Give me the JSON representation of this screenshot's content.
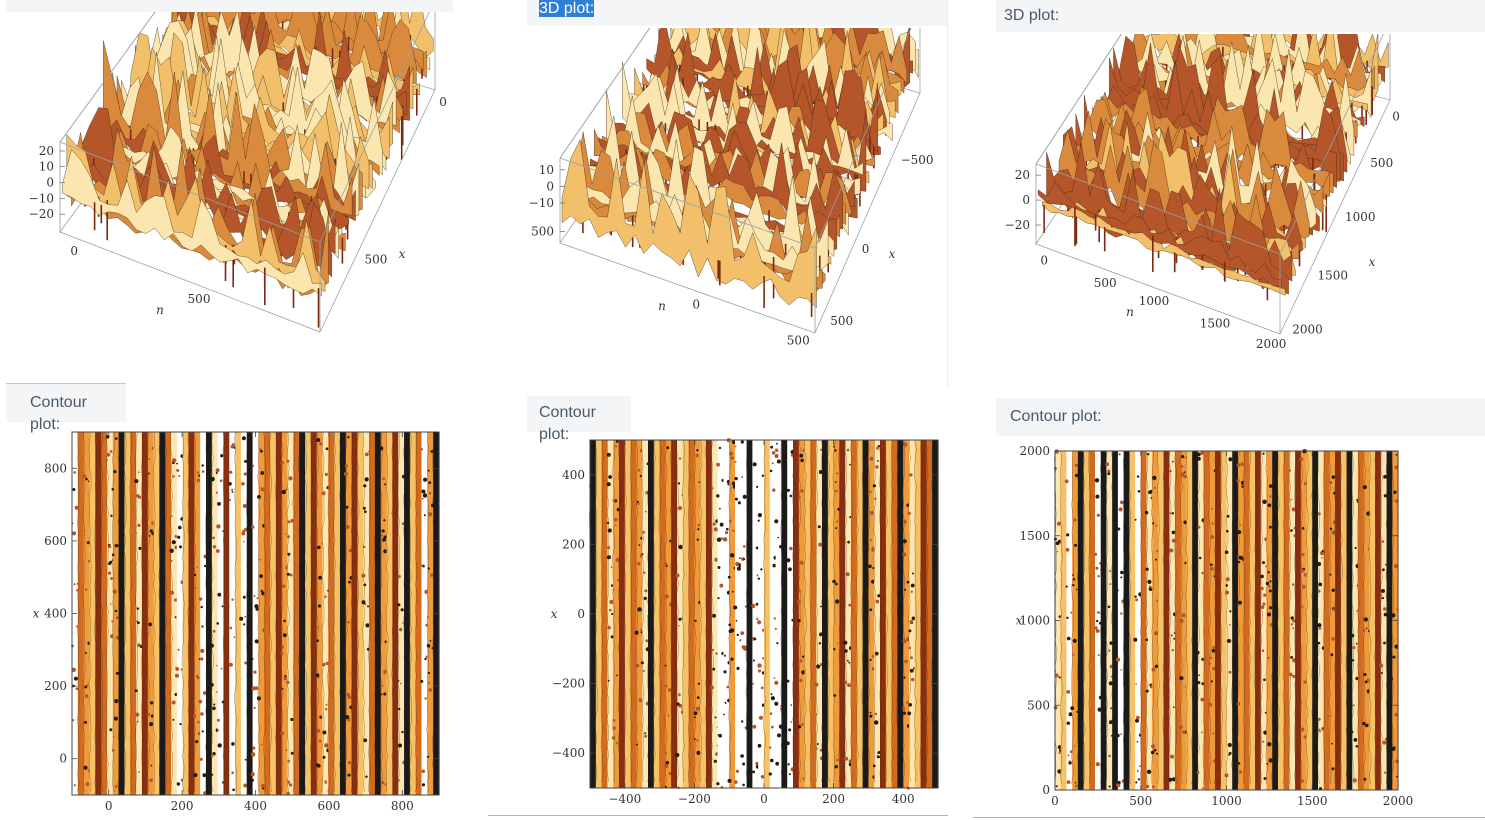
{
  "panels": [
    {
      "label_3d": "",
      "label_contour": "Contour plot:",
      "plot3d": {
        "z_ticks": [
          "20",
          "10",
          "0",
          "−10",
          "−20"
        ],
        "n_ticks": [
          "0",
          "500"
        ],
        "x_ticks": [
          "500",
          "0"
        ],
        "n_label": "n",
        "x_label": "x"
      }
    },
    {
      "label_3d": "3D plot:",
      "label_contour": "Contour plot:",
      "plot3d": {
        "z_ticks": [
          "10",
          "0",
          "−10",
          "−500"
        ],
        "n_ticks": [
          "0",
          "500"
        ],
        "x_ticks": [
          "500",
          "0",
          "−500"
        ],
        "n_label": "n",
        "x_label": "x"
      }
    },
    {
      "label_3d": "3D plot:",
      "label_contour": "Contour plot:",
      "plot3d": {
        "z_ticks": [
          "20",
          "0",
          "−20"
        ],
        "n_ticks": [
          "0",
          "500",
          "1000",
          "1500",
          "2000"
        ],
        "x_ticks": [
          "2000",
          "1500",
          "1000",
          "500",
          "0"
        ],
        "n_label": "n",
        "x_label": "x"
      }
    }
  ],
  "chart_data": [
    {
      "type": "surface",
      "xlabel": "n",
      "ylabel": "x",
      "n_ticks": [
        0,
        500
      ],
      "x_ticks": [
        0,
        500
      ],
      "z_ticks": [
        -20,
        -10,
        0,
        10,
        20
      ],
      "zlim": [
        -20,
        20
      ],
      "colormap": [
        "#7a2a10",
        "#b5562a",
        "#d98a3c",
        "#f2c06a",
        "#fbe6b0"
      ]
    },
    {
      "type": "surface",
      "xlabel": "n",
      "ylabel": "x",
      "n_ticks": [
        0,
        500
      ],
      "x_ticks": [
        -500,
        0,
        500
      ],
      "z_ticks": [
        -500,
        -10,
        0,
        10
      ],
      "colormap": [
        "#7a2a10",
        "#b5562a",
        "#d98a3c",
        "#f2c06a",
        "#fbe6b0"
      ]
    },
    {
      "type": "surface",
      "xlabel": "n",
      "ylabel": "x",
      "n_ticks": [
        0,
        500,
        1000,
        1500,
        2000
      ],
      "x_ticks": [
        0,
        500,
        1000,
        1500,
        2000
      ],
      "z_ticks": [
        -20,
        0,
        20
      ],
      "zlim": [
        -20,
        20
      ],
      "colormap": [
        "#7a2a10",
        "#b5562a",
        "#d98a3c",
        "#f2c06a",
        "#fbe6b0"
      ]
    },
    {
      "type": "heatmap",
      "ylabel": "x",
      "xlim": [
        -100,
        900
      ],
      "ylim": [
        -100,
        900
      ],
      "x_ticks": [
        0,
        200,
        400,
        600,
        800
      ],
      "y_ticks": [
        0,
        200,
        400,
        600,
        800
      ],
      "orientation": "vertical-bands",
      "colormap": [
        "#ffffff",
        "#fde6b0",
        "#f7c165",
        "#f09a3a",
        "#d26b1e",
        "#8a2e10",
        "#1a1a1a"
      ],
      "band_levels": [
        0,
        4,
        3,
        2,
        5,
        4,
        1,
        3,
        6,
        2,
        4,
        1,
        5,
        3,
        2,
        6,
        4,
        1,
        0,
        2,
        5,
        3,
        0,
        6,
        1,
        0,
        5,
        0,
        2,
        0,
        6,
        0,
        3,
        4,
        2,
        5,
        3,
        1,
        4,
        6,
        2,
        5,
        3,
        1,
        4,
        2,
        6,
        3,
        5,
        2,
        1,
        4,
        6,
        3,
        2,
        5,
        1,
        6,
        2,
        4,
        0,
        3,
        6
      ]
    },
    {
      "type": "heatmap",
      "ylabel": "x",
      "xlim": [
        -500,
        500
      ],
      "ylim": [
        -500,
        500
      ],
      "x_ticks": [
        -400,
        -200,
        0,
        200,
        400
      ],
      "y_ticks": [
        -400,
        -200,
        0,
        200,
        400
      ],
      "orientation": "vertical-bands",
      "colormap": [
        "#ffffff",
        "#fde6b0",
        "#f7c165",
        "#f09a3a",
        "#d26b1e",
        "#8a2e10",
        "#1a1a1a"
      ],
      "band_levels": [
        6,
        2,
        4,
        1,
        3,
        5,
        2,
        4,
        3,
        1,
        6,
        2,
        4,
        3,
        5,
        1,
        2,
        4,
        3,
        2,
        5,
        1,
        0,
        0,
        3,
        0,
        0,
        6,
        0,
        0,
        2,
        0,
        0,
        6,
        0,
        5,
        3,
        2,
        4,
        1,
        6,
        2,
        3,
        5,
        1,
        4,
        2,
        6,
        3,
        1,
        5,
        2,
        4,
        6,
        3,
        1,
        2,
        5,
        4,
        6
      ]
    },
    {
      "type": "heatmap",
      "ylabel": "x",
      "xlim": [
        0,
        2000
      ],
      "ylim": [
        0,
        2000
      ],
      "x_ticks": [
        0,
        500,
        1000,
        1500,
        2000
      ],
      "y_ticks": [
        0,
        500,
        1000,
        1500,
        2000
      ],
      "orientation": "vertical-bands",
      "colormap": [
        "#ffffff",
        "#fde6b0",
        "#f7c165",
        "#f09a3a",
        "#d26b1e",
        "#8a2e10",
        "#1a1a1a"
      ],
      "band_levels": [
        1,
        2,
        0,
        3,
        6,
        2,
        4,
        0,
        6,
        1,
        6,
        0,
        6,
        2,
        0,
        4,
        1,
        3,
        2,
        5,
        1,
        4,
        3,
        2,
        6,
        1,
        4,
        3,
        5,
        2,
        1,
        6,
        3,
        4,
        2,
        5,
        1,
        3,
        6,
        2,
        4,
        1,
        5,
        3,
        2,
        6,
        1,
        4,
        3,
        5,
        2,
        6,
        1,
        4,
        3,
        2,
        5,
        1,
        6,
        3
      ]
    }
  ]
}
